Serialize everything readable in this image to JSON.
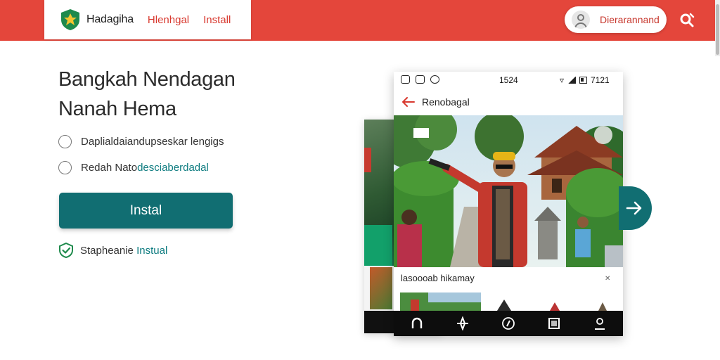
{
  "header": {
    "brand": "Hadagiha",
    "nav": [
      "Hlenhgal",
      "Install"
    ],
    "user_label": "Dierarannand",
    "colors": {
      "bar": "#e4463b",
      "accent": "#d8392f"
    }
  },
  "hero": {
    "title_line1": "Bangkah Nendagan",
    "title_line2": "Nanah Hema",
    "options": [
      {
        "text": "Daplialdaiandupseskar lengigs",
        "accent": ""
      },
      {
        "text": "Redah Nato",
        "accent": "desciaberdadal"
      }
    ],
    "install_label": "Instal",
    "secure_text": "Stapheanie",
    "secure_accent": "Instual",
    "accent_color": "#116e72"
  },
  "phone": {
    "status_time": "1524",
    "status_right": "7121",
    "appbar_title": "Renobagal",
    "caption": "lasoooab hikamay",
    "nav_icons": [
      "home-icon",
      "explore-icon",
      "compass-icon",
      "square-icon",
      "profile-icon"
    ]
  }
}
